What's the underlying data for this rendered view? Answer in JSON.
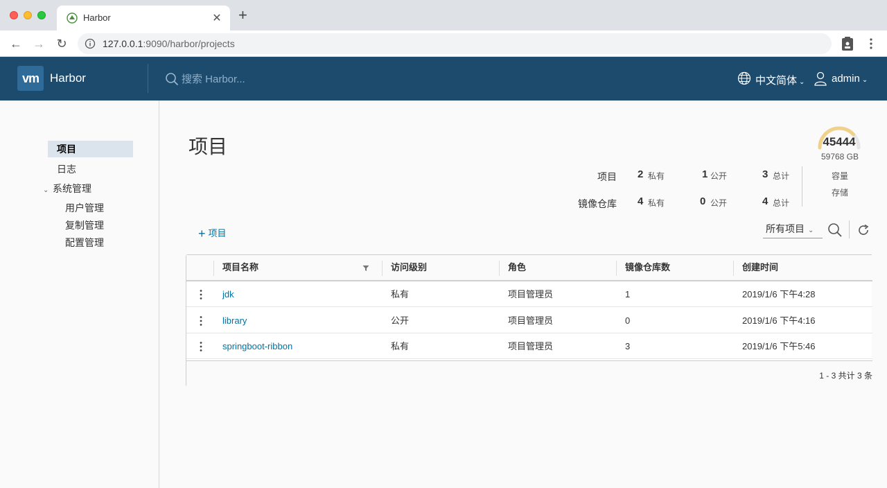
{
  "browser": {
    "tab_title": "Harbor",
    "url_host": "127.0.0.1",
    "url_rest": ":9090/harbor/projects"
  },
  "header": {
    "brand": "Harbor",
    "logo_text": "vm",
    "search_placeholder": "搜索 Harbor...",
    "language": "中文简体",
    "user": "admin"
  },
  "sidebar": {
    "items": [
      {
        "label": "项目"
      },
      {
        "label": "日志"
      }
    ],
    "group": {
      "label": "系统管理",
      "children": [
        {
          "label": "用户管理"
        },
        {
          "label": "复制管理"
        },
        {
          "label": "配置管理"
        }
      ]
    }
  },
  "main": {
    "title": "项目",
    "stats": {
      "projects_label": "项目",
      "repos_label": "镜像仓库",
      "private_text": "私有",
      "public_text": "公开",
      "total_text": "总计",
      "projects": {
        "private": "2",
        "public": "1",
        "total": "3"
      },
      "repos": {
        "private": "4",
        "public": "0",
        "total": "4"
      }
    },
    "capacity": {
      "used": "45444",
      "total": "59768 GB",
      "used_fraction": 0.76,
      "label": "容量",
      "sublabel": "存储"
    },
    "add_button": "项目",
    "filter_select": "所有项目",
    "table": {
      "columns": [
        "项目名称",
        "访问级别",
        "角色",
        "镜像仓库数",
        "创建时间"
      ],
      "rows": [
        {
          "name": "jdk",
          "access": "私有",
          "role": "项目管理员",
          "repos": "1",
          "created": "2019/1/6 下午4:28"
        },
        {
          "name": "library",
          "access": "公开",
          "role": "项目管理员",
          "repos": "0",
          "created": "2019/1/6 下午4:16"
        },
        {
          "name": "springboot-ribbon",
          "access": "私有",
          "role": "项目管理员",
          "repos": "3",
          "created": "2019/1/6 下午5:46"
        }
      ],
      "pagination": "1 - 3 共计 3 条"
    }
  },
  "colors": {
    "header_bg": "#1d4b6e",
    "link": "#0072a3",
    "gauge_fill": "#f1d08a"
  }
}
